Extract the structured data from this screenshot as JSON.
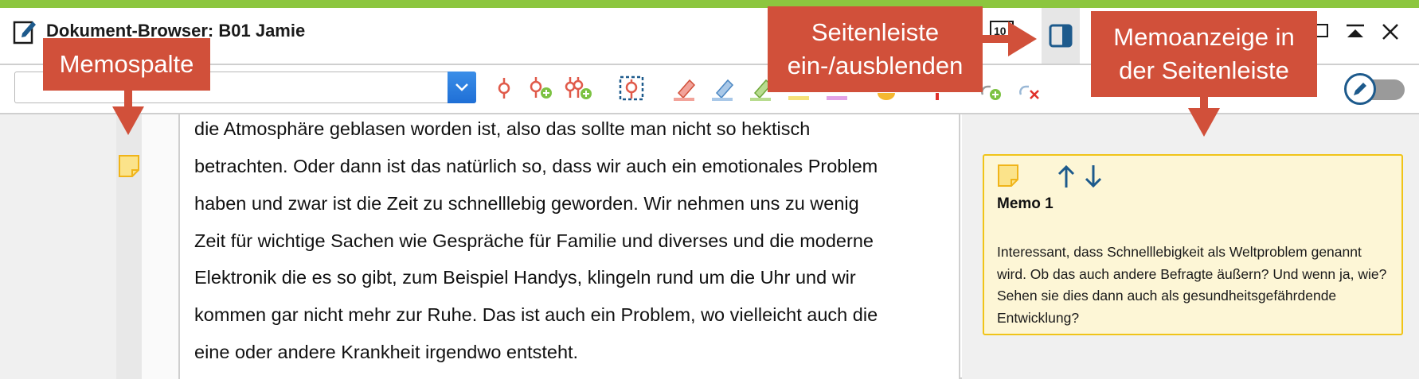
{
  "window": {
    "title": "Dokument-Browser: B01 Jamie"
  },
  "colors": {
    "accent_green": "#8cc63f",
    "callout_red": "#d1503a",
    "memo_yellow_bg": "#fdf6d6",
    "memo_yellow_border": "#f0c419",
    "icon_blue": "#1d5a8c"
  },
  "titlebar_icons": [
    "edit-document-icon",
    "overview-icon",
    "sidebar-toggle-icon",
    "restore-window-icon",
    "collapse-icon",
    "close-icon"
  ],
  "toolbar": {
    "combo_value": "",
    "tools": [
      "code-icon",
      "add-code-icon",
      "code-multiple-icon",
      "select-code-icon",
      "highlight-red-icon",
      "highlight-blue-icon",
      "highlight-green-icon",
      "highlight-yellow-icon",
      "highlight-purple-icon",
      "emoticode-icon",
      "red-pin-icon",
      "link-add-icon",
      "link-remove-icon"
    ]
  },
  "document": {
    "lines": [
      "die Atmosphäre geblasen worden ist, also das sollte man nicht so hektisch",
      "betrachten. Oder dann ist das natürlich so, dass wir auch ein emotionales Problem",
      "haben und zwar ist die Zeit zu schnelllebig geworden. Wir nehmen uns zu wenig",
      "Zeit für wichtige Sachen wie Gespräche für Familie und diverses und die moderne",
      "Elektronik die es so gibt, zum Beispiel Handys, klingeln rund um die Uhr und wir",
      "kommen gar nicht mehr zur Ruhe. Das ist auch ein Problem, wo vielleicht auch die",
      "eine oder andere Krankheit irgendwo entsteht."
    ]
  },
  "memo": {
    "title": "Memo 1",
    "text": "Interessant, dass Schnelllebigkeit als Weltproblem genannt wird. Ob das auch andere Befragte äußern? Und wenn ja, wie? Sehen sie dies dann auch als gesundheitsgefährdende Entwicklung?"
  },
  "callouts": {
    "memospalte": "Memospalte",
    "seitenleiste_line1": "Seitenleiste",
    "seitenleiste_line2": "ein-/ausblenden",
    "memoanzeige_line1": "Memoanzeige in",
    "memoanzeige_line2": "der Seitenleiste"
  }
}
